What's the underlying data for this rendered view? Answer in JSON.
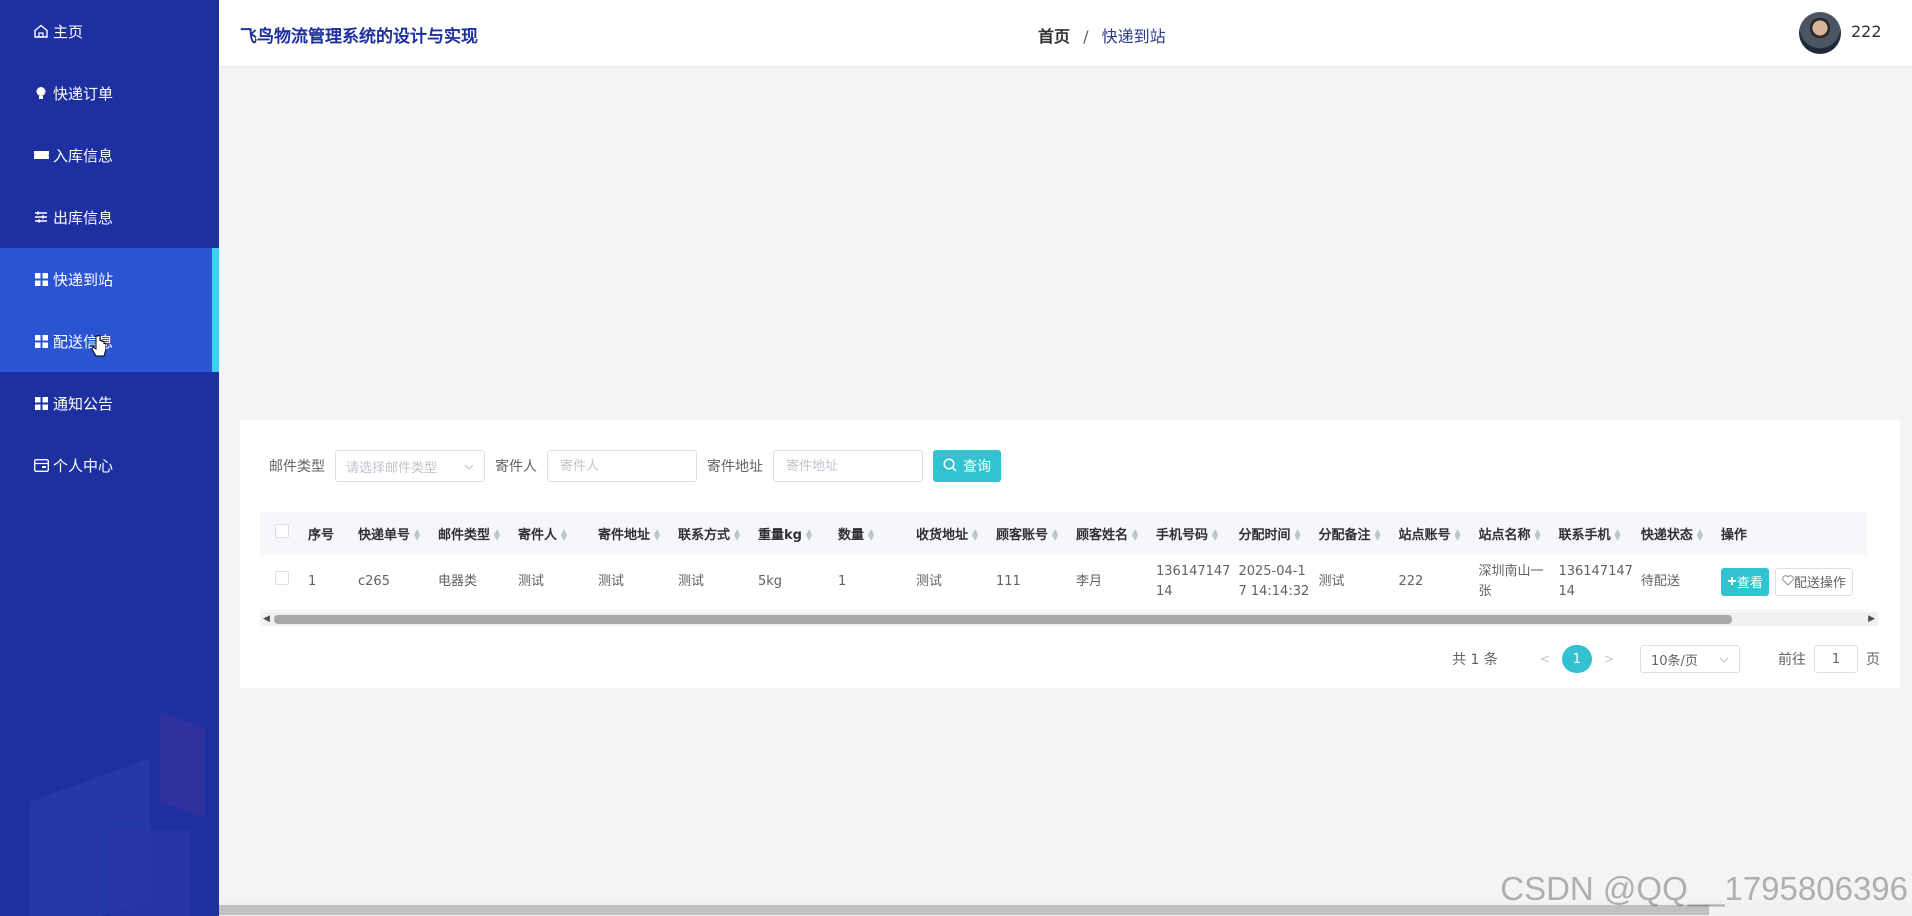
{
  "sidebar": {
    "items": [
      {
        "label": "主页",
        "icon": "home-icon"
      },
      {
        "label": "快递订单",
        "icon": "bulb-icon"
      },
      {
        "label": "入库信息",
        "icon": "ticket-icon"
      },
      {
        "label": "出库信息",
        "icon": "sliders-icon"
      },
      {
        "label": "快递到站",
        "icon": "grid-icon"
      },
      {
        "label": "配送信息",
        "icon": "grid-icon"
      },
      {
        "label": "通知公告",
        "icon": "grid-icon"
      },
      {
        "label": "个人中心",
        "icon": "card-icon"
      }
    ],
    "active_index": 4,
    "accent": "#38d4ec",
    "bg": "#1e30a0"
  },
  "header": {
    "title": "飞鸟物流管理系统的设计与实现",
    "breadcrumb_home": "首页",
    "breadcrumb_sep": "/",
    "breadcrumb_current": "快递到站",
    "username": "222"
  },
  "filters": {
    "mail_type_label": "邮件类型",
    "mail_type_placeholder": "请选择邮件类型",
    "sender_label": "寄件人",
    "sender_placeholder": "寄件人",
    "address_label": "寄件地址",
    "address_placeholder": "寄件地址",
    "search_label": "查询"
  },
  "table": {
    "columns": [
      "序号",
      "快递单号",
      "邮件类型",
      "寄件人",
      "寄件地址",
      "联系方式",
      "重量kg",
      "数量",
      "收货地址",
      "顾客账号",
      "顾客姓名",
      "手机号码",
      "分配时间",
      "分配备注",
      "站点账号",
      "站点名称",
      "联系手机",
      "快递状态",
      "操作"
    ],
    "rows": [
      {
        "cells": [
          "1",
          "c265",
          "电器类",
          "测试",
          "测试",
          "测试",
          "5kg",
          "1",
          "测试",
          "111",
          "李月",
          "136147147 14",
          "2025-04-1 7 14:14:32",
          "测试",
          "222",
          "深圳南山一 张",
          "136147147 14",
          "待配送"
        ],
        "view_label": "查看",
        "deliver_label": "配送操作"
      }
    ]
  },
  "pagination": {
    "total": "共 1 条",
    "prev": "<",
    "current": "1",
    "next": ">",
    "page_size": "10条/页",
    "goto_label": "前往",
    "goto_value": "1",
    "page_suffix": "页"
  },
  "watermark": "CSDN @QQ__1795806396",
  "colors": {
    "primary": "#33c3d0",
    "title": "#1e30a0"
  }
}
